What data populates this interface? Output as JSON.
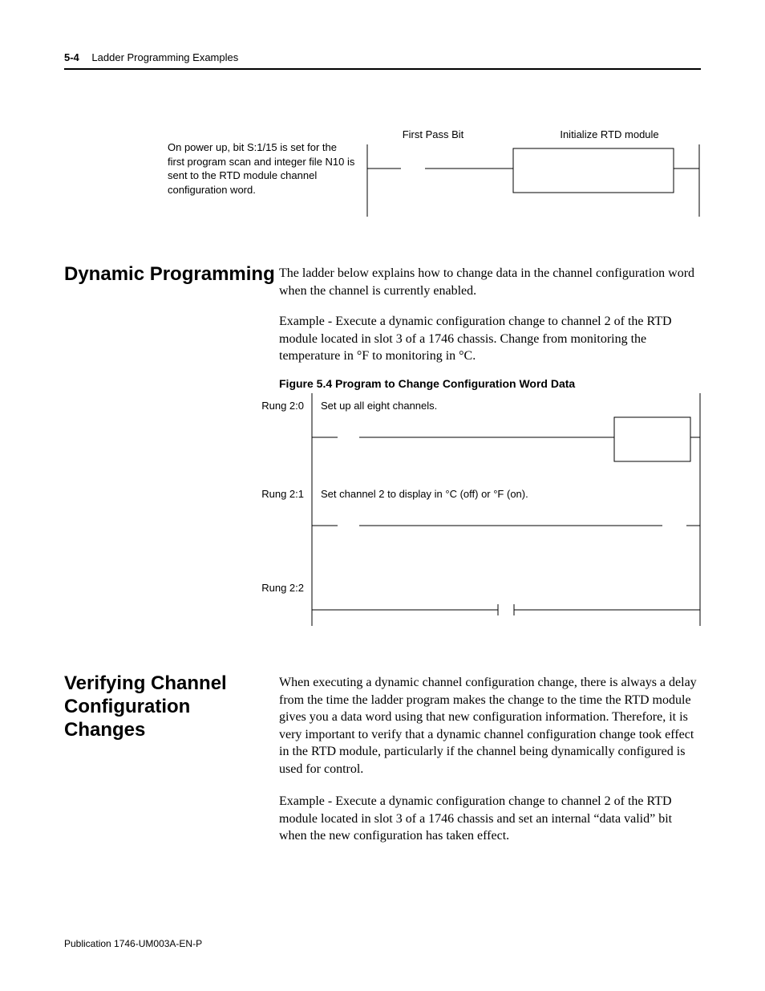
{
  "header": {
    "page_num": "5-4",
    "chapter": "Ladder Programming Examples"
  },
  "ladder_top": {
    "note": "On power up, bit S:1/15 is set for the first program scan and integer file N10 is sent to the RTD module channel configuration word.",
    "first_pass": "First Pass Bit",
    "init_rtd": "Initialize RTD module"
  },
  "sec1": {
    "heading": "Dynamic Programming",
    "p1": "The ladder below explains how to change data in the channel configuration word when the channel is currently enabled.",
    "p2": "Example - Execute a dynamic configuration change to channel 2 of the RTD module located in slot 3 of a 1746 chassis. Change from monitoring the temperature in °F to monitoring in °C."
  },
  "figure": {
    "caption": "Figure 5.4 Program to Change Configuration Word Data",
    "rung0": {
      "label": "Rung 2:0",
      "comment": "Set up all eight channels."
    },
    "rung1": {
      "label": "Rung 2:1",
      "comment": "Set channel 2 to display in °C (off) or °F (on)."
    },
    "rung2": {
      "label": "Rung 2:2"
    }
  },
  "sec2": {
    "heading": "Verifying Channel Configuration Changes",
    "p1": "When executing a dynamic channel configuration change, there is always a delay from the time the ladder program makes the change to the time the RTD module gives you a data word using that new configuration information. Therefore, it is very important to verify that a dynamic channel configuration change took effect in the RTD module, particularly if the channel being dynamically configured is used for control.",
    "p2": "Example - Execute a dynamic configuration change to channel 2 of the RTD module located in slot 3 of a 1746 chassis and set an internal “data valid” bit when the new configuration has taken effect."
  },
  "footer": {
    "publication": "Publication 1746-UM003A-EN-P"
  }
}
